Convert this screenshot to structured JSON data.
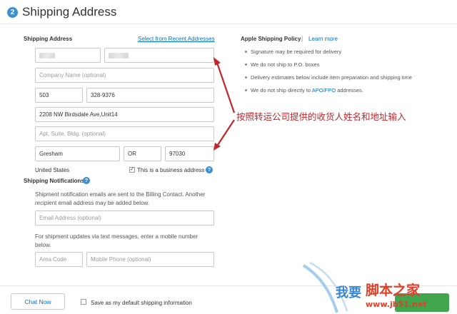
{
  "header": {
    "step_number": "2",
    "title": "Shipping Address"
  },
  "form": {
    "section_label": "Shipping Address",
    "recent_link": "Select from Recent Addresses",
    "company_placeholder": "Company Name (optional)",
    "area_code": "503",
    "phone": "328-9376",
    "street": "2208 NW Birdsdale Ave,Unit14",
    "apt_placeholder": "Apt, Suite, Bldg. (optional)",
    "city": "Gresham",
    "state": "OR",
    "zip": "97030",
    "country": "United States",
    "business_checkbox_label": "This is a business address",
    "business_checked": true
  },
  "notifications": {
    "title": "Shipping Notifications",
    "email_desc_line1": "Shipment notification emails are sent to the Billing Contact. Another",
    "email_desc_line2": "recipient email address may be added below.",
    "email_placeholder": "Email Address (optional)",
    "sms_desc_line1": "For shipment updates via text messages, enter a mobile number",
    "sms_desc_line2": "below.",
    "area_placeholder": "Area Code",
    "mobile_placeholder": "Mobile Phone (optional)"
  },
  "policy": {
    "title": "Apple Shipping Policy",
    "separator": "|",
    "learn_more": "Learn more",
    "items": [
      "Signature may be required for delivery",
      "We do not ship to P.O. boxes",
      "Delivery estimates below include item preparation and shipping time"
    ],
    "apo_prefix": "We do not ship directly to ",
    "apo_link": "APO/FPO",
    "apo_suffix": " addresses."
  },
  "annotation": "按照转运公司提供的收货人姓名和地址输入",
  "footer": {
    "chat_button": "Chat Now",
    "save_default_label": "Save as my default shipping information",
    "save_default_checked": false
  },
  "watermark": {
    "line1": "我要",
    "line2": "脚本之家",
    "line3": "www.jb51.net"
  },
  "colors": {
    "accent": "#3d8fd1",
    "link": "#0070c9",
    "annotation": "#c0272d"
  }
}
